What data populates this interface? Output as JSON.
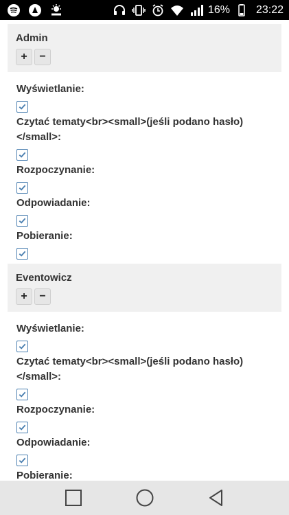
{
  "status_bar": {
    "battery_percent": "16%",
    "time": "23:22",
    "left_icons": [
      "spotify-icon",
      "app-icon",
      "weather-icon"
    ],
    "right_icons": [
      "headphones-icon",
      "vibrate-icon",
      "alarm-icon",
      "wifi-icon",
      "signal-icon",
      "battery-icon"
    ]
  },
  "groups": [
    {
      "name": "Admin",
      "plus_label": "+",
      "minus_label": "−",
      "permissions": [
        {
          "label": "Wyświetlanie:",
          "checked": true
        },
        {
          "label": "Czytać tematy<br><small>(jeśli podano hasło)</small>:",
          "checked": true
        },
        {
          "label": "Rozpoczynanie:",
          "checked": true
        },
        {
          "label": "Odpowiadanie:",
          "checked": true
        },
        {
          "label": "Pobieranie:",
          "checked": true
        }
      ]
    },
    {
      "name": "Eventowicz",
      "plus_label": "+",
      "minus_label": "−",
      "permissions": [
        {
          "label": "Wyświetlanie:",
          "checked": true
        },
        {
          "label": "Czytać tematy<br><small>(jeśli podano hasło)</small>:",
          "checked": true
        },
        {
          "label": "Rozpoczynanie:",
          "checked": true
        },
        {
          "label": "Odpowiadanie:",
          "checked": true
        },
        {
          "label": "Pobieranie:",
          "checked": true
        }
      ]
    }
  ],
  "colors": {
    "checkbox_border": "#4a7fb0",
    "group_header_bg": "#f0f0f0",
    "nav_bar_bg": "#e6e6e6"
  }
}
